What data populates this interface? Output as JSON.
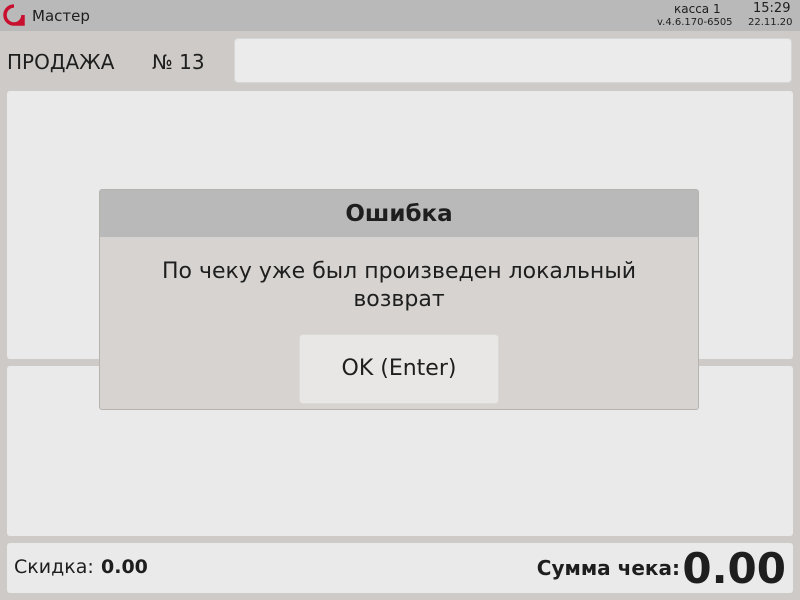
{
  "titlebar": {
    "app_title": "Мастер",
    "logo_icon": "app-logo-icon",
    "logo_color": "#c8102e",
    "register": "касса 1",
    "time": "15:29",
    "version": "v.4.6.170-6505",
    "date": "22.11.20"
  },
  "sale": {
    "label": "ПРОДАЖА",
    "number": "№ 13",
    "search_value": ""
  },
  "footer": {
    "discount_label": "Скидка:",
    "discount_value": "0.00",
    "total_label": "Сумма чека:",
    "total_value": "0.00"
  },
  "dialog": {
    "title": "Ошибка",
    "message": "По чеку уже был произведен локальный возврат",
    "ok_label": "OK (Enter)"
  }
}
